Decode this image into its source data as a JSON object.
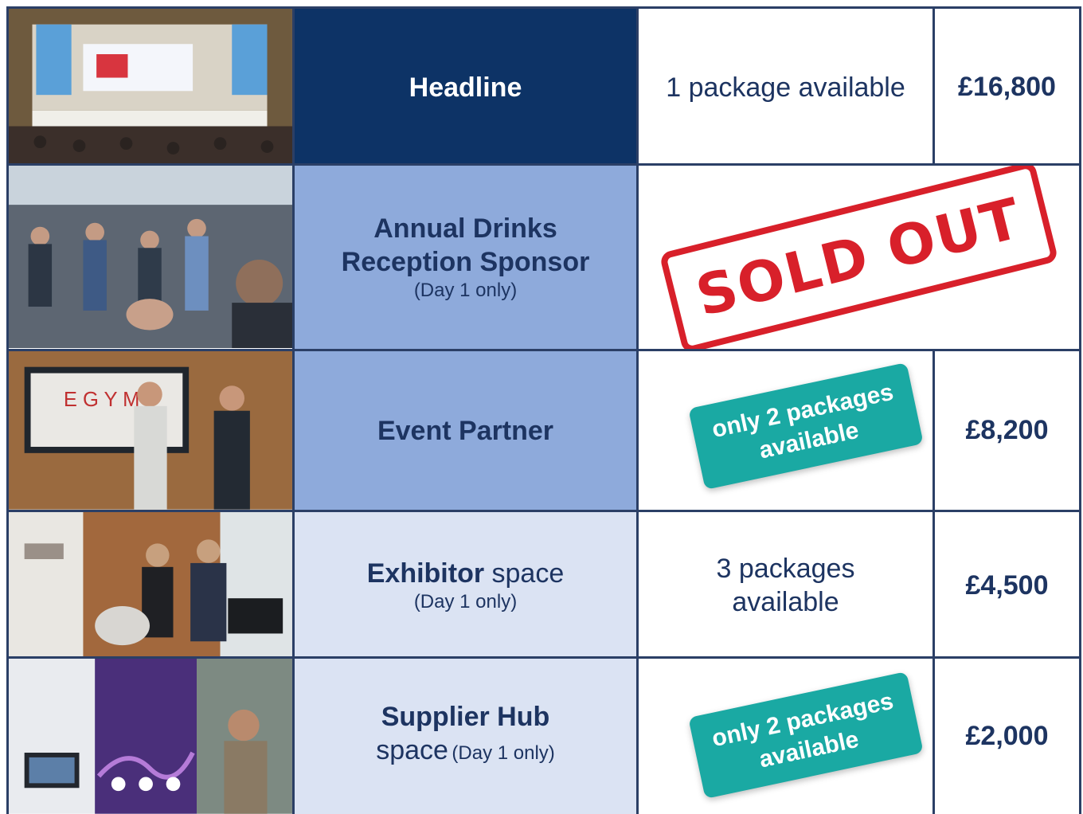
{
  "rows": [
    {
      "name_bold": "Headline",
      "name_rest": "",
      "sub": "",
      "availability": "1 package available",
      "price": "£16,800"
    },
    {
      "name_bold": "Annual Drinks Reception Sponsor",
      "name_rest": "",
      "sub": "(Day 1 only)",
      "stamp": "SOLD OUT"
    },
    {
      "name_bold": "Event Partner",
      "name_rest": "",
      "sub": "",
      "badge": "only 2 packages available",
      "price": "£8,200"
    },
    {
      "name_bold": "Exhibitor",
      "name_rest": " space",
      "sub": "(Day 1 only)",
      "availability": "3 packages available",
      "price": "£4,500"
    },
    {
      "name_bold": "Supplier Hub",
      "name_rest": "space",
      "sub": "(Day 1 only)",
      "badge": "only 2 packages available",
      "price": "£2,000"
    }
  ],
  "colors": {
    "navy": "#0d3366",
    "mid_blue": "#8eaadb",
    "light_blue": "#dbe3f3",
    "teal_badge": "#1aa9a3",
    "stamp_red": "#d8202a"
  }
}
